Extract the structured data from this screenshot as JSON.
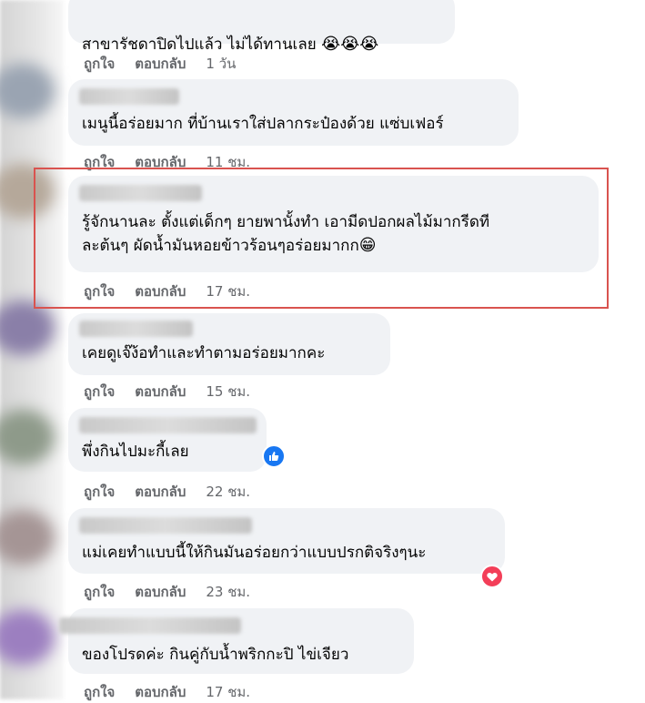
{
  "comments": [
    {
      "text": "สาขารัชดาปิดไปแล้ว ไม่ได้ทานเลย",
      "emoji": "😭😭😭",
      "like": "ถูกใจ",
      "reply": "ตอบกลับ",
      "time": "1 วัน"
    },
    {
      "text": "เมนูนี้อร่อยมาก ที่บ้านเราใส่ปลากระป๋องด้วย แซ่บเฟอร์",
      "like": "ถูกใจ",
      "reply": "ตอบกลับ",
      "time": "11 ชม."
    },
    {
      "text": "รู้จักนานละ ตั้งแต่เด็กๆ ยายพานั้งทำ เอามีดปอกผลไม้มากรีดที\nละต้นๆ ผัดน้ำมันหอยข้าวร้อนๆอร่อยมากก",
      "emoji": "😁",
      "like": "ถูกใจ",
      "reply": "ตอบกลับ",
      "time": "17 ชม."
    },
    {
      "text": "เคยดูเจ๊ง้อทำและทำตามอร่อยมากคะ",
      "like": "ถูกใจ",
      "reply": "ตอบกลับ",
      "time": "15 ชม."
    },
    {
      "text": "พึ่งกินไปมะกี้เลย",
      "like": "ถูกใจ",
      "reply": "ตอบกลับ",
      "time": "22 ชม.",
      "reaction": "like-icon"
    },
    {
      "text": "แม่เคยทำแบบนี้ให้กินมันอร่อยกว่าแบบปรกติจริงๆนะ",
      "like": "ถูกใจ",
      "reply": "ตอบกลับ",
      "time": "23 ชม.",
      "reaction": "heart-icon"
    },
    {
      "text": "ของโปรดค่ะ กินคู่กับน้ำพริกกะปิ ไข่เจียว",
      "like": "ถูกใจ",
      "reply": "ตอบกลับ",
      "time": "17 ชม."
    }
  ],
  "colors": {
    "highlight": "#d9534f",
    "like": "#1877f2",
    "heart": "#f33e58",
    "bubble": "#f0f2f5",
    "meta": "#65676b"
  }
}
